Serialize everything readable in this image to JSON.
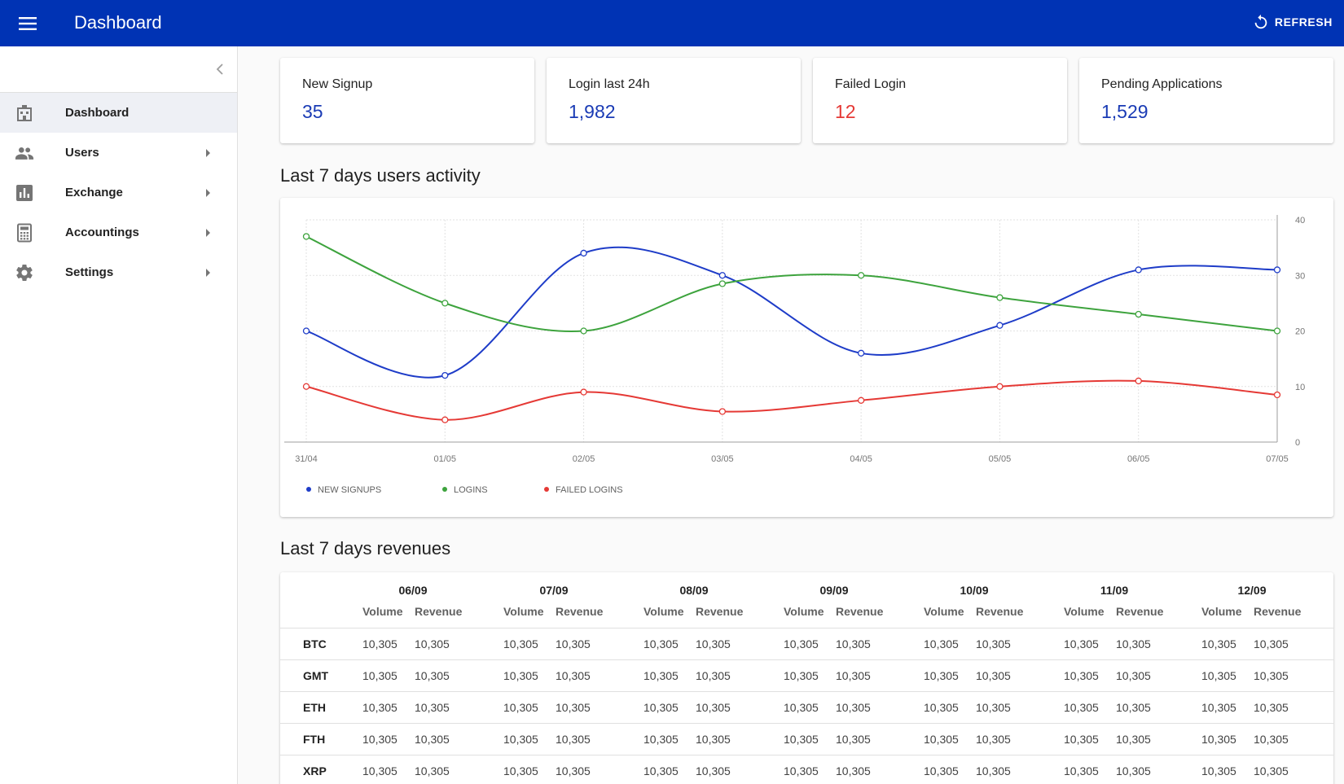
{
  "header": {
    "title": "Dashboard",
    "refresh_label": "REFRESH"
  },
  "sidebar": {
    "items": [
      {
        "label": "Dashboard",
        "icon": "dashboard-icon",
        "active": true,
        "has_submenu": false
      },
      {
        "label": "Users",
        "icon": "people-icon",
        "active": false,
        "has_submenu": true
      },
      {
        "label": "Exchange",
        "icon": "bar-chart-icon",
        "active": false,
        "has_submenu": true
      },
      {
        "label": "Accountings",
        "icon": "calculator-icon",
        "active": false,
        "has_submenu": true
      },
      {
        "label": "Settings",
        "icon": "gear-icon",
        "active": false,
        "has_submenu": true
      }
    ]
  },
  "stats": [
    {
      "label": "New Signup",
      "value": "35",
      "color": "#1a3bb5"
    },
    {
      "label": "Login last 24h",
      "value": "1,982",
      "color": "#1a3bb5"
    },
    {
      "label": "Failed Login",
      "value": "12",
      "color": "#e53935"
    },
    {
      "label": "Pending Applications",
      "value": "1,529",
      "color": "#1a3bb5"
    }
  ],
  "activity": {
    "title": "Last 7 days users activity"
  },
  "chart_data": {
    "type": "line",
    "x": [
      "31/04",
      "01/05",
      "02/05",
      "03/05",
      "04/05",
      "05/05",
      "06/05",
      "07/05"
    ],
    "series": [
      {
        "name": "NEW SIGNUPS",
        "color": "#1e3cc8",
        "values": [
          20,
          12,
          34,
          30,
          16,
          21,
          31,
          31
        ]
      },
      {
        "name": "LOGINS",
        "color": "#3da33d",
        "values": [
          37,
          25,
          20,
          28.5,
          30,
          26,
          23,
          20
        ]
      },
      {
        "name": "FAILED LOGINS",
        "color": "#e53935",
        "values": [
          10,
          4,
          9,
          5.5,
          7.5,
          10,
          11,
          8.5
        ]
      }
    ],
    "y_ticks": [
      "0",
      "10",
      "20",
      "30",
      "40"
    ],
    "ylim": [
      0,
      40
    ],
    "grid": true,
    "legend_position": "bottom-left",
    "y_axis_side": "right"
  },
  "revenues": {
    "title": "Last 7 days revenues",
    "dates": [
      "06/09",
      "07/09",
      "08/09",
      "09/09",
      "10/09",
      "11/09",
      "12/09"
    ],
    "volume_label": "Volume",
    "revenue_label": "Revenue",
    "rows": [
      {
        "coin": "BTC",
        "cells": [
          "10,305",
          "10,305",
          "10,305",
          "10,305",
          "10,305",
          "10,305",
          "10,305",
          "10,305",
          "10,305",
          "10,305",
          "10,305",
          "10,305",
          "10,305",
          "10,305"
        ]
      },
      {
        "coin": "GMT",
        "cells": [
          "10,305",
          "10,305",
          "10,305",
          "10,305",
          "10,305",
          "10,305",
          "10,305",
          "10,305",
          "10,305",
          "10,305",
          "10,305",
          "10,305",
          "10,305",
          "10,305"
        ]
      },
      {
        "coin": "ETH",
        "cells": [
          "10,305",
          "10,305",
          "10,305",
          "10,305",
          "10,305",
          "10,305",
          "10,305",
          "10,305",
          "10,305",
          "10,305",
          "10,305",
          "10,305",
          "10,305",
          "10,305"
        ]
      },
      {
        "coin": "FTH",
        "cells": [
          "10,305",
          "10,305",
          "10,305",
          "10,305",
          "10,305",
          "10,305",
          "10,305",
          "10,305",
          "10,305",
          "10,305",
          "10,305",
          "10,305",
          "10,305",
          "10,305"
        ]
      },
      {
        "coin": "XRP",
        "cells": [
          "10,305",
          "10,305",
          "10,305",
          "10,305",
          "10,305",
          "10,305",
          "10,305",
          "10,305",
          "10,305",
          "10,305",
          "10,305",
          "10,305",
          "10,305",
          "10,305"
        ]
      }
    ]
  }
}
